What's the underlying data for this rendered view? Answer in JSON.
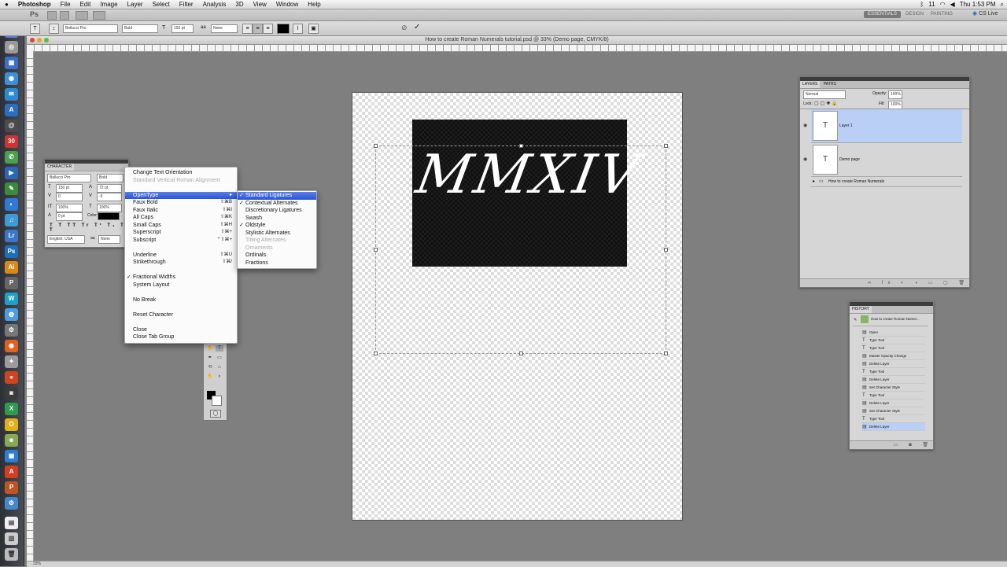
{
  "menubar": {
    "apple": "",
    "app": "Photoshop",
    "items": [
      "File",
      "Edit",
      "Image",
      "Layer",
      "Select",
      "Filter",
      "Analysis",
      "3D",
      "View",
      "Window",
      "Help"
    ],
    "clock": "Thu 1:53 PM",
    "battery": "11"
  },
  "appbar": {
    "logo": "Ps",
    "workspaces": [
      "ESSENTIALS",
      "DESIGN",
      "PAINTING"
    ],
    "cs_live": "CS Live"
  },
  "options": {
    "tool": "T",
    "font_family": "Bellucci Pro",
    "font_style": "Bold",
    "font_size": "150 pt",
    "antialias": "None"
  },
  "document": {
    "title": "How to create Roman Numerals tutorial.psd @ 33% (Demo page, CMYK/8)",
    "text": "MMXIV",
    "zoom": "33%"
  },
  "character_panel": {
    "title": "CHARACTER",
    "font": "Bellucci Pro",
    "style": "Bold",
    "size": "150 pt",
    "leading": "72 pt",
    "kerning": "0",
    "tracking": "-5",
    "vscale": "100%",
    "hscale": "100%",
    "baseline": "0 pt",
    "color_label": "Color:",
    "language": "English: USA",
    "aa": "None"
  },
  "context_menu": {
    "items": [
      {
        "label": "Change Text Orientation",
        "enabled": true
      },
      {
        "label": "Standard Vertical Roman Alignment",
        "enabled": false
      },
      {
        "label": "OpenType",
        "enabled": true,
        "highlighted": true,
        "submenu": true
      },
      {
        "label": "Faux Bold",
        "shortcut": "⇧⌘B"
      },
      {
        "label": "Faux Italic",
        "shortcut": "⇧⌘I"
      },
      {
        "label": "All Caps",
        "shortcut": "⇧⌘K"
      },
      {
        "label": "Small Caps",
        "shortcut": "⇧⌘H"
      },
      {
        "label": "Superscript",
        "shortcut": "⇧⌘+"
      },
      {
        "label": "Subscript",
        "shortcut": "⌃⇧⌘+"
      },
      {
        "label": "Underline",
        "shortcut": "⇧⌘U"
      },
      {
        "label": "Strikethrough",
        "shortcut": "⇧⌘/"
      },
      {
        "label": "Fractional Widths",
        "checked": true
      },
      {
        "label": "System Layout"
      },
      {
        "label": "No Break"
      },
      {
        "label": "Reset Character"
      },
      {
        "label": "Close"
      },
      {
        "label": "Close Tab Group"
      }
    ]
  },
  "opentype_submenu": {
    "items": [
      {
        "label": "Standard Ligatures",
        "checked": true,
        "highlighted": true
      },
      {
        "label": "Contextual Alternates",
        "checked": true
      },
      {
        "label": "Discretionary Ligatures"
      },
      {
        "label": "Swash"
      },
      {
        "label": "Oldstyle",
        "checked": true
      },
      {
        "label": "Stylistic Alternates"
      },
      {
        "label": "Titling Alternates",
        "enabled": false
      },
      {
        "label": "Ornaments",
        "enabled": false
      },
      {
        "label": "Ordinals"
      },
      {
        "label": "Fractions"
      }
    ]
  },
  "layers_panel": {
    "tabs": [
      "LAYERS",
      "PATHS"
    ],
    "blend_mode": "Normal",
    "opacity_label": "Opacity:",
    "opacity": "100%",
    "lock_label": "Lock:",
    "fill_label": "Fill:",
    "fill": "100%",
    "layers": [
      {
        "name": "Layer 1",
        "type": "T",
        "selected": true
      },
      {
        "name": "Demo page",
        "type": "T",
        "selected": false
      }
    ],
    "group": "How to create Roman Numerals"
  },
  "history_panel": {
    "title": "HISTORY",
    "snapshot": "How to create Roman Numer...",
    "items": [
      "Open",
      "Type Tool",
      "Type Tool",
      "Master Opacity Change",
      "Delete Layer",
      "Type Tool",
      "Delete Layer",
      "Set Character Style",
      "Type Tool",
      "Delete Layer",
      "Set Character Style",
      "Type Tool",
      "Delete Layer"
    ]
  },
  "status": {
    "zoom": "33%"
  },
  "colors": {
    "highlight": "#2b55d7",
    "layer_selected": "#b9cff5"
  }
}
